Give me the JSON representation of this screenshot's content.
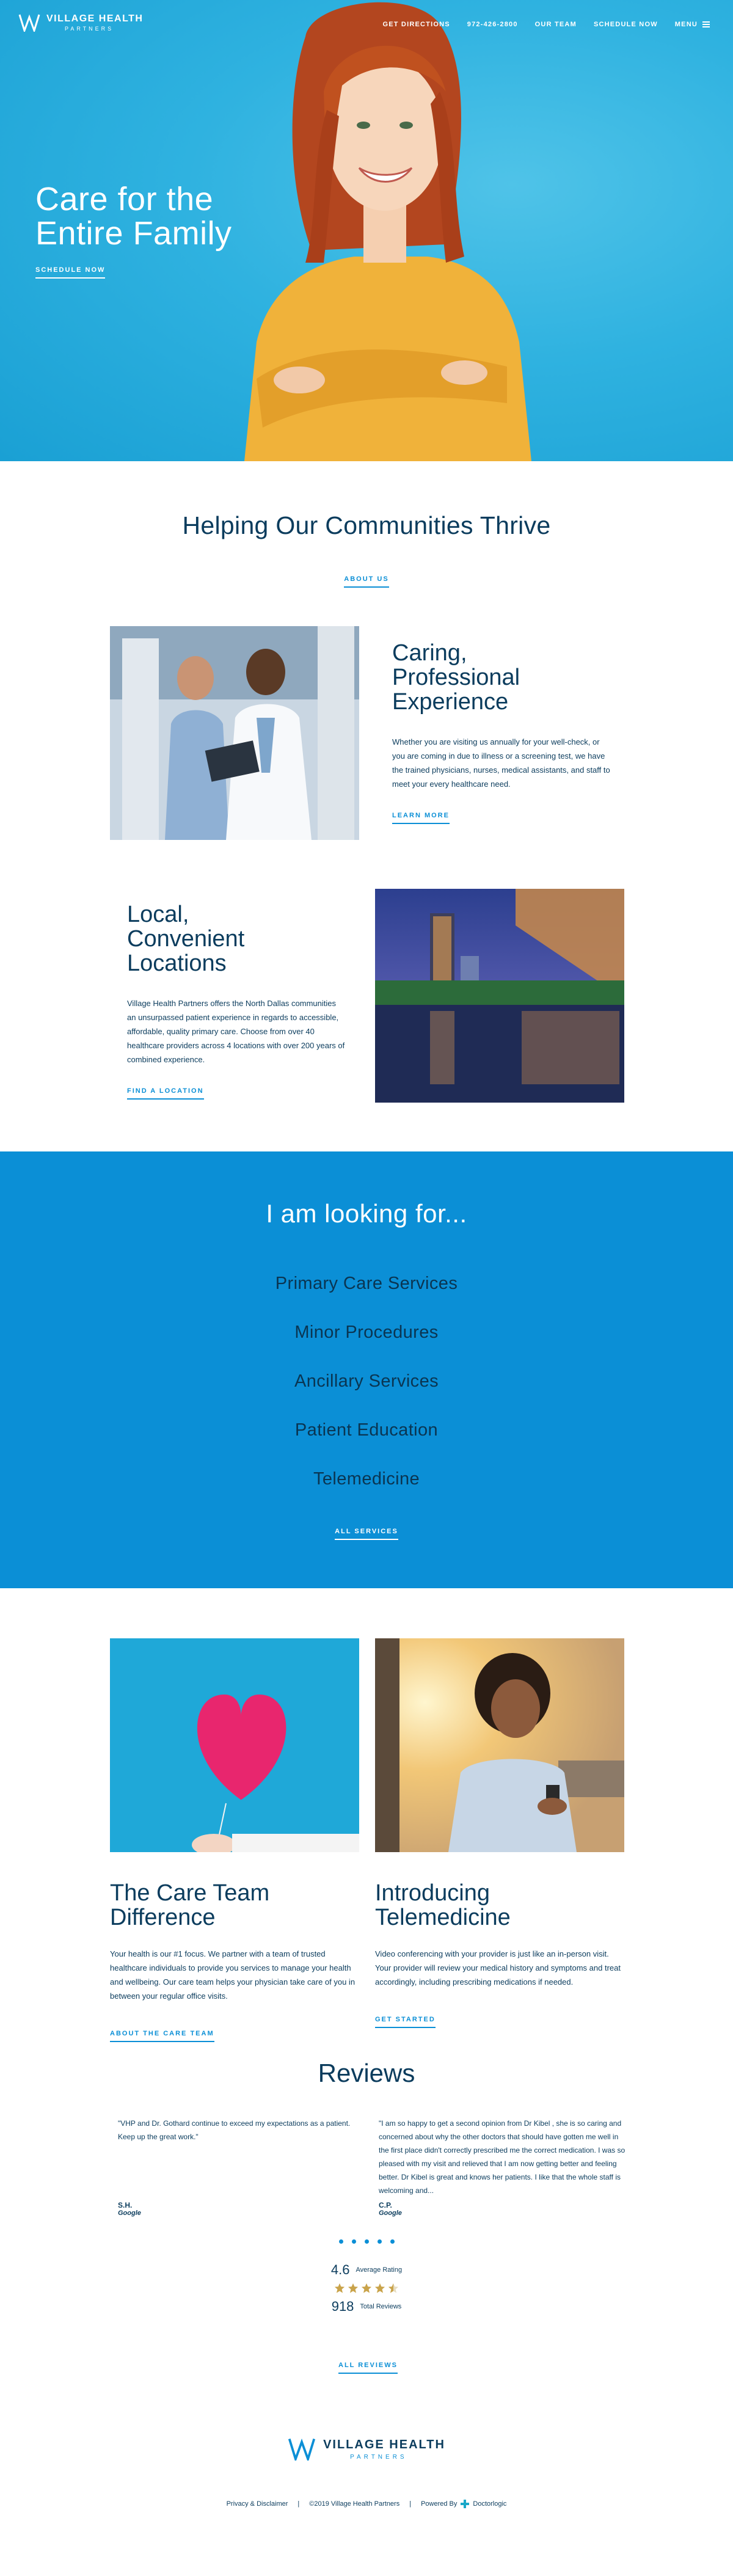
{
  "brand": {
    "name": "VILLAGE HEALTH",
    "sub": "PARTNERS"
  },
  "nav": {
    "directions": "GET DIRECTIONS",
    "phone": "972-426-2800",
    "team": "OUR TEAM",
    "schedule": "SCHEDULE NOW",
    "menu": "MENU"
  },
  "hero": {
    "title_line1": "Care for the",
    "title_line2": "Entire Family",
    "cta": "SCHEDULE NOW"
  },
  "thrive": {
    "heading": "Helping Our Communities Thrive",
    "link": "ABOUT US"
  },
  "features": [
    {
      "title": [
        "Caring,",
        "Professional",
        "Experience"
      ],
      "body": "Whether you are visiting us annually for your well-check, or you are coming in due to illness or a screening test, we have the trained physicians, nurses, medical assistants, and staff to meet your every healthcare need.",
      "link": "LEARN MORE"
    },
    {
      "title": [
        "Local,",
        "Convenient",
        "Locations"
      ],
      "body": "Village Health Partners offers the North Dallas communities an unsurpassed patient experience in regards to accessible, affordable, quality primary care. Choose from over 40 healthcare providers across 4 locations with over 200 years of combined experience.",
      "link": "FIND A LOCATION"
    }
  ],
  "looking": {
    "heading": "I am looking for...",
    "items": [
      "Primary Care Services",
      "Minor Procedures",
      "Ancillary Services",
      "Patient Education",
      "Telemedicine"
    ],
    "link": "ALL SERVICES"
  },
  "cards": [
    {
      "title": [
        "The Care Team",
        "Difference"
      ],
      "body": "Your health is our #1 focus. We partner with a team of trusted healthcare individuals to provide you services to manage your health and wellbeing. Our care team helps your physician take care of you in between your regular office visits.",
      "link": "ABOUT THE CARE TEAM"
    },
    {
      "title": [
        "Introducing",
        "Telemedicine"
      ],
      "body": "Video conferencing with your provider is just like an in-person visit. Your provider will review your medical history and symptoms and treat accordingly, including prescribing medications if needed.",
      "link": "GET STARTED"
    }
  ],
  "reviews": {
    "heading": "Reviews",
    "items": [
      {
        "text": "\"VHP and Dr. Gothard continue to exceed my expectations as a patient. Keep up the great work.\"",
        "who": "S.H.",
        "src": "Google"
      },
      {
        "text": "\"I am so happy to get a second opinion from Dr Kibel , she is so caring and concerned about why the other doctors that should have gotten me well in the first place didn't correctly prescribed me the correct medication. I was so pleased with my visit and relieved that I am now getting better and feeling better. Dr Kibel is great and knows her patients. I like that the whole staff is welcoming and...",
        "who": "C.P.",
        "src": "Google"
      }
    ],
    "rating": "4.6",
    "rating_label": "Average Rating",
    "stars": 4.5,
    "total": "918",
    "total_label": "Total Reviews",
    "link": "ALL REVIEWS"
  },
  "footer": {
    "privacy": "Privacy & Disclaimer",
    "copyright": "©2019 Village Health Partners",
    "powered": "Powered By",
    "provider": "Doctorlogic"
  },
  "colors": {
    "accent": "#0b8fd6",
    "navy": "#0b3c5d",
    "hero": "#2fb2e0"
  }
}
